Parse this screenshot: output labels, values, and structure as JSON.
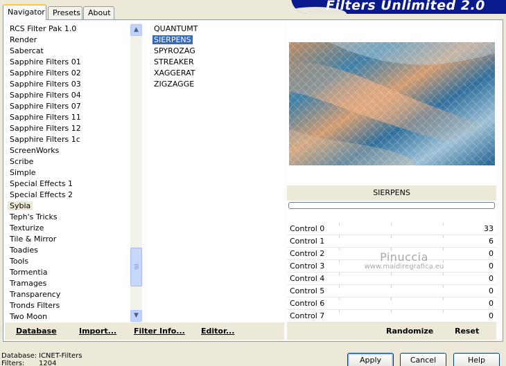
{
  "header": {
    "title": "Filters Unlimited 2.0"
  },
  "tabs": [
    {
      "label": "Navigator",
      "active": true
    },
    {
      "label": "Presets",
      "active": false
    },
    {
      "label": "About",
      "active": false
    }
  ],
  "categories": {
    "selected": "Sybia",
    "items": [
      "RCS Filter Pak 1.0",
      "Render",
      "Sabercat",
      "Sapphire Filters 01",
      "Sapphire Filters 02",
      "Sapphire Filters 03",
      "Sapphire Filters 04",
      "Sapphire Filters 07",
      "Sapphire Filters 11",
      "Sapphire Filters 12",
      "Sapphire Filters 1c",
      "ScreenWorks",
      "Scribe",
      "Simple",
      "Special Effects 1",
      "Special Effects 2",
      "Sybia",
      "Teph's Tricks",
      "Texturize",
      "Tile & Mirror",
      "Toadies",
      "Tools",
      "Tormentia",
      "Tramages",
      "Transparency",
      "Tronds Filters",
      "Two Moon"
    ]
  },
  "filters": {
    "selected": "SIERPENS",
    "items": [
      "QUANTUMT",
      "SIERPENS",
      "SPYROZAG",
      "STREAKER",
      "XAGGERAT",
      "ZIGZAGGE"
    ]
  },
  "preview": {
    "filter_name": "SIERPENS"
  },
  "controls": [
    {
      "label": "Control 0",
      "value": "33"
    },
    {
      "label": "Control 1",
      "value": "6"
    },
    {
      "label": "Control 2",
      "value": "0"
    },
    {
      "label": "Control 3",
      "value": "0"
    },
    {
      "label": "Control 4",
      "value": "0"
    },
    {
      "label": "Control 5",
      "value": "0"
    },
    {
      "label": "Control 6",
      "value": "0"
    },
    {
      "label": "Control 7",
      "value": "0"
    }
  ],
  "watermark": {
    "line1": "Pinuccia",
    "line2": "www.maidiregrafica.eu"
  },
  "toolbar_left": {
    "database": "Database",
    "import": "Import...",
    "filter_info": "Filter Info...",
    "editor": "Editor..."
  },
  "toolbar_right": {
    "randomize": "Randomize",
    "reset": "Reset"
  },
  "status": {
    "database_label": "Database:",
    "database_value": "ICNET-Filters",
    "filters_label": "Filters:",
    "filters_value": "1204"
  },
  "buttons": {
    "apply": "Apply",
    "cancel": "Cancel",
    "help": "Help"
  }
}
